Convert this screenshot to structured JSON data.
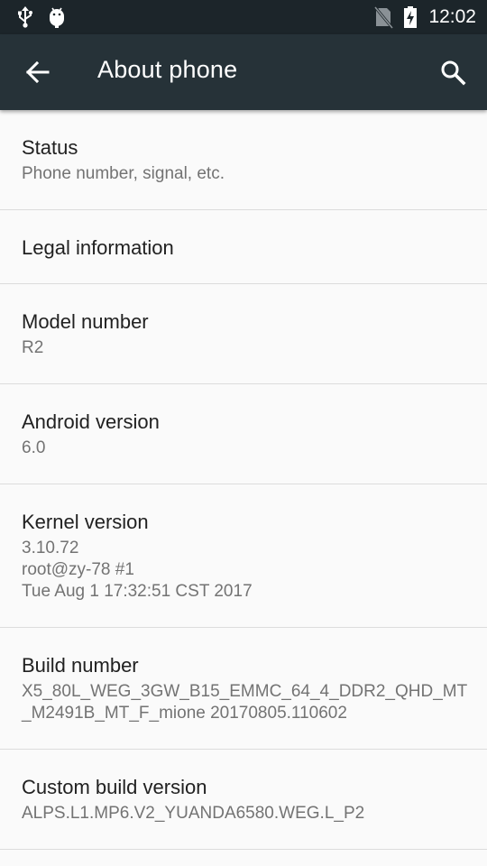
{
  "status_bar": {
    "time": "12:02",
    "left_icons": [
      "usb-icon",
      "android-debug-icon"
    ],
    "right_icons": [
      "no-sim-icon",
      "battery-charging-icon"
    ]
  },
  "toolbar": {
    "title": "About phone",
    "back_icon": "arrow-back-icon",
    "search_icon": "search-icon"
  },
  "items": [
    {
      "title": "Status",
      "summary": [
        "Phone number, signal, etc."
      ]
    },
    {
      "title": "Legal information",
      "summary": []
    },
    {
      "title": "Model number",
      "summary": [
        "R2"
      ]
    },
    {
      "title": "Android version",
      "summary": [
        "6.0"
      ]
    },
    {
      "title": "Kernel version",
      "summary": [
        "3.10.72",
        "root@zy-78 #1",
        "Tue Aug 1 17:32:51 CST 2017"
      ]
    },
    {
      "title": "Build number",
      "summary": [
        "X5_80L_WEG_3GW_B15_EMMC_64_4_DDR2_QHD_MT_M2491B_MT_F_mione 20170805.110602"
      ]
    },
    {
      "title": "Custom build version",
      "summary": [
        "ALPS.L1.MP6.V2_YUANDA6580.WEG.L_P2"
      ]
    }
  ],
  "colors": {
    "status_bar": "#1c252a",
    "toolbar": "#263238",
    "background": "#fafafa",
    "divider": "#dcdcdc"
  }
}
